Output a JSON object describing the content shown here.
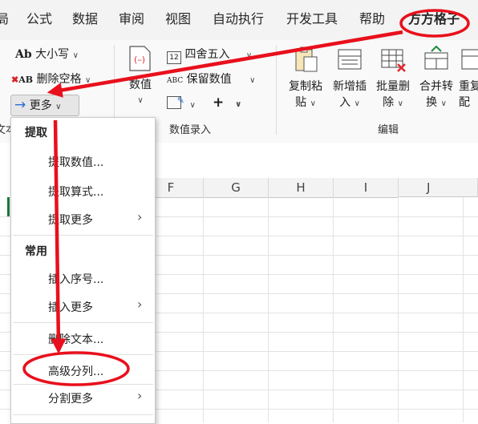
{
  "tabs": [
    "局",
    "公式",
    "数据",
    "审阅",
    "视图",
    "自动执行",
    "开发工具",
    "帮助",
    "方方格子"
  ],
  "active_tab": "方方格子",
  "ribbon": {
    "text_group": {
      "case_label": "大小写",
      "delete_space_label": "删除空格",
      "more_label": "更多",
      "group_label": "文本"
    },
    "numeric_group": {
      "numeric_label": "数值",
      "round_label": "四舍五入",
      "keep_numeric_label": "保留数值",
      "plus_label": "+",
      "group_label": "数值录入"
    },
    "edit_group": {
      "copy_paste_line1": "复制粘",
      "copy_paste_line2": "贴",
      "new_insert_line1": "新增插",
      "new_insert_line2": "入",
      "batch_delete_line1": "批量删",
      "batch_delete_line2": "除",
      "merge_convert_line1": "合并转",
      "merge_convert_line2": "换",
      "partial_line1": "重复",
      "partial_line2": "配",
      "group_label": "编辑"
    }
  },
  "columns": [
    "F",
    "G",
    "H",
    "I",
    "J"
  ],
  "menu": {
    "sections": [
      {
        "title": "提取",
        "items": [
          {
            "label": "提取数值...",
            "submenu": false
          },
          {
            "label": "提取算式...",
            "submenu": false
          },
          {
            "label": "提取更多",
            "submenu": true
          }
        ]
      },
      {
        "title": "常用",
        "items": [
          {
            "label": "插入序号...",
            "submenu": false
          },
          {
            "label": "插入更多",
            "submenu": true
          },
          {
            "label": "删除文本...",
            "submenu": false
          },
          {
            "label": "高级分列...",
            "submenu": false,
            "highlighted": true
          },
          {
            "label": "分割更多",
            "submenu": true
          }
        ]
      }
    ]
  },
  "annotation_color": "#e8101c"
}
